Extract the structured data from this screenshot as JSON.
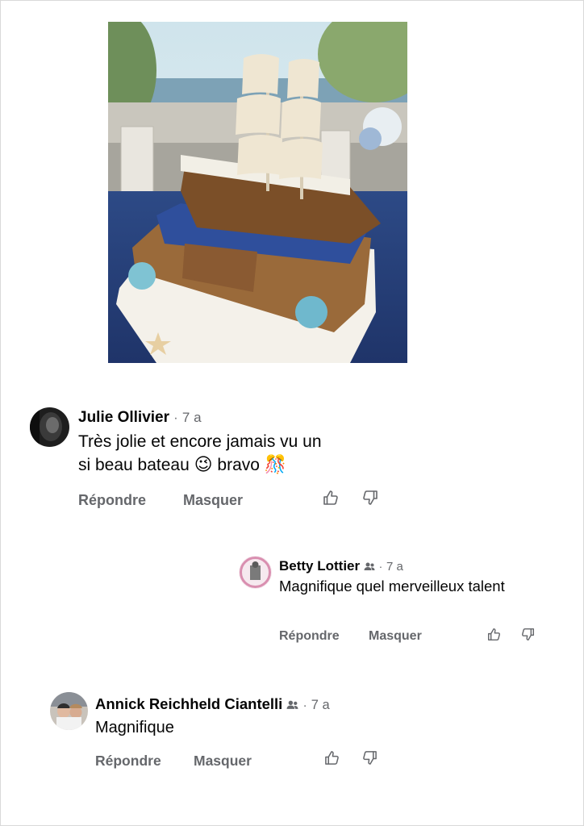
{
  "comments": [
    {
      "author": "Julie Ollivier",
      "separator": "·",
      "time": "7 a",
      "text_line1": "Très jolie et encore jamais vu un",
      "text_line2": "si beau bateau",
      "emoji_wink": "😉",
      "text_after": "bravo",
      "emoji_party": "🎊",
      "reply_label": "Répondre",
      "hide_label": "Masquer"
    },
    {
      "author": "Betty Lottier",
      "separator": "·",
      "time": "7 a",
      "text": "Magnifique quel merveilleux talent",
      "reply_label": "Répondre",
      "hide_label": "Masquer"
    },
    {
      "author": "Annick Reichheld Ciantelli",
      "separator": "·",
      "time": "7 a",
      "text": "Magnifique",
      "reply_label": "Répondre",
      "hide_label": "Masquer"
    }
  ],
  "icons": {
    "like": "thumbs-up-icon",
    "dislike": "thumbs-down-icon",
    "group": "group-member-icon"
  },
  "colors": {
    "meta_text": "#65676b",
    "primary_text": "#050505"
  }
}
